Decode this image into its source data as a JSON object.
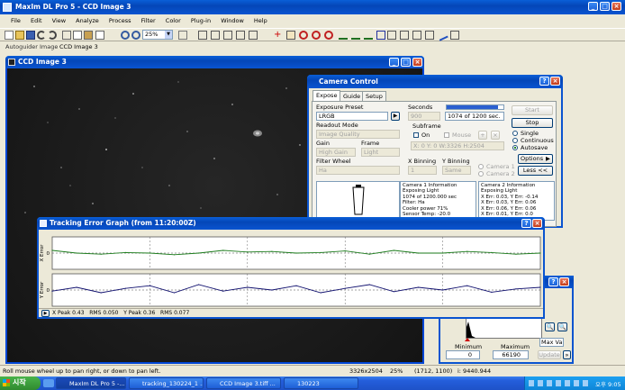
{
  "app": {
    "title": "MaxIm DL Pro 5 - CCD Image 3",
    "menu": [
      "File",
      "Edit",
      "View",
      "Analyze",
      "Process",
      "Filter",
      "Color",
      "Plug-in",
      "Window",
      "Help"
    ],
    "zoom": "25%",
    "doc_tabs": [
      "Autoguider Image",
      "CCD Image 3"
    ]
  },
  "image_window": {
    "title": "CCD Image 3"
  },
  "camera_control": {
    "title": "Camera Control",
    "tabs": [
      "Expose",
      "Guide",
      "Setup"
    ],
    "exposure_preset_label": "Exposure Preset",
    "exposure_preset_value": "LRGB",
    "readout_mode_label": "Readout Mode",
    "readout_mode_value": "Image Quality",
    "gain_label": "Gain",
    "gain_value": "High Gain",
    "frame_label": "Frame",
    "frame_value": "Light",
    "filter_wheel_label": "Filter Wheel",
    "filter_wheel_value": "Ha",
    "seconds_label": "Seconds",
    "seconds_value": "900",
    "progress_text": "1074 of 1200 sec.",
    "progress_fraction": 0.9,
    "subframe_label": "Subframe",
    "on_label": "On",
    "mouse_label": "Mouse",
    "subframe_coords": "X: 0 Y: 0 W:3326 H:2504",
    "xbin_label": "X Binning",
    "xbin_value": "1",
    "ybin_label": "Y Binning",
    "ybin_value": "Same",
    "camera1_label": "Camera 1",
    "camera2_label": "Camera 2",
    "start_label": "Start",
    "stop_label": "Stop",
    "single_label": "Single",
    "continuous_label": "Continuous",
    "autosave_label": "Autosave",
    "options_label": "Options",
    "less_label": "Less <<",
    "cam1_info": [
      "Camera 1 Information",
      "Exposing Light",
      "1074 of 1200.000 sec",
      "Filter: Ha",
      "Cooler power 71%",
      "Sensor Temp: -20.0"
    ],
    "cam2_info": [
      "Camera 2 Information",
      "Exposing Light",
      "X Err: 0.03, Y Err: -0.14",
      "X Err: 0.03, Y Err: 0.06",
      "X Err: 0.06, Y Err: 0.06",
      "X Err: 0.01, Y Err: 0.0"
    ]
  },
  "tracking_graph": {
    "title": "Tracking Error Graph (from 11:20:00Z)",
    "x_axis_label": "X Error",
    "y_axis_label": "Y Error",
    "x_ticks": [
      "2160",
      "2280",
      "2400",
      "2520",
      "2640",
      "2760"
    ],
    "x_ticks_x_numeric": [
      2160,
      2280,
      2400,
      2520,
      2640,
      2760
    ],
    "y_tick": "0",
    "status": "X Peak 0.43   RMS 0.050   Y Peak 0.36   RMS 0.077",
    "chart_data": {
      "type": "line",
      "xlim": [
        2160,
        2760
      ],
      "series": [
        {
          "name": "X Error",
          "color": "#1a7a1a",
          "x": [
            2160,
            2190,
            2220,
            2250,
            2280,
            2310,
            2340,
            2370,
            2400,
            2430,
            2460,
            2490,
            2520,
            2550,
            2580,
            2610,
            2640,
            2670,
            2700,
            2730,
            2760
          ],
          "values": [
            0.05,
            0.0,
            -0.02,
            0.01,
            0.0,
            -0.03,
            0.0,
            0.05,
            0.02,
            0.03,
            0.0,
            0.01,
            0.04,
            -0.02,
            0.05,
            0.0,
            0.0,
            0.03,
            0.01,
            -0.02,
            0.0
          ]
        },
        {
          "name": "Y Error",
          "color": "#10106e",
          "x": [
            2160,
            2190,
            2220,
            2250,
            2280,
            2310,
            2340,
            2370,
            2400,
            2430,
            2460,
            2490,
            2520,
            2550,
            2580,
            2610,
            2640,
            2670,
            2700,
            2730,
            2760
          ],
          "values": [
            -0.02,
            0.05,
            -0.05,
            0.03,
            0.08,
            -0.05,
            0.1,
            -0.02,
            0.05,
            0.0,
            0.08,
            -0.05,
            0.03,
            0.1,
            -0.03,
            0.05,
            0.0,
            0.08,
            -0.04,
            0.02,
            0.05
          ]
        }
      ]
    }
  },
  "screen_stretch": {
    "minimum_label": "Minimum",
    "maximum_label": "Maximum",
    "min_value": "0",
    "max_value": "66190",
    "max_val_label": "Max Va",
    "update_label": "Update"
  },
  "status_bar": {
    "hint": "Roll mouse wheel up to pan right, or down to pan left.",
    "size": "3326x2504",
    "zoom": "25%",
    "coords": "(1712, 1100)",
    "intensity": "i: 9440.944"
  },
  "taskbar": {
    "start_label": "시작",
    "items": [
      "MaxIm DL Pro 5 -...",
      "tracking_130224_1 ...",
      "CCD Image 3.tiff ...",
      "130223"
    ],
    "clock": "오후 9:05"
  },
  "colors": {
    "title_bar": "#0a54d0",
    "image_bg": "#1a1a1a",
    "plot_bg": "#ffffff",
    "x_series": "#1a7a1a",
    "y_series": "#10106e",
    "taskbar": "#245edb",
    "start_button": "#3a9a3a"
  }
}
